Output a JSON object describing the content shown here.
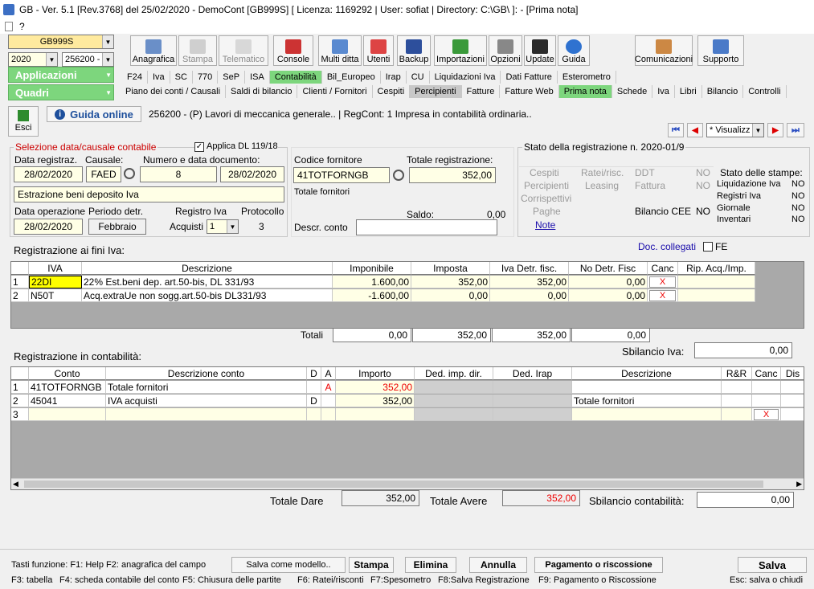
{
  "window": {
    "title": "GB - Ver. 5.1 [Rev.3768] del 25/02/2020 - DemoCont [GB999S]   [ Licenza: 1169292 | User: sofiat | Directory: C:\\GB\\ ]: - [Prima nota]",
    "menu_item": "?"
  },
  "selectors": {
    "company": "GB999S",
    "year": "2020",
    "register": "256200 -"
  },
  "toolbar": [
    "Anagrafica",
    "Stampa",
    "Telematico",
    "Console",
    "Multi ditta",
    "Utenti",
    "Backup",
    "Importazioni",
    "Opzioni",
    "Update",
    "Guida",
    "Comunicazioni",
    "Supporto"
  ],
  "sections": {
    "applicazioni": "Applicazioni",
    "quadri": "Quadri"
  },
  "tabs_row1": [
    "F24",
    "Iva",
    "SC",
    "770",
    "SeP",
    "ISA",
    "Contabilità",
    "Bil_Europeo",
    "Irap",
    "CU",
    "Liquidazioni Iva",
    "Dati Fatture",
    "Esterometro"
  ],
  "tabs_row2": [
    "Piano dei conti / Causali",
    "Saldi di bilancio",
    "Clienti / Fornitori",
    "Cespiti",
    "Percipienti",
    "Fatture",
    "Fatture Web",
    "Prima nota",
    "Schede",
    "Iva",
    "Libri",
    "Bilancio",
    "Controlli"
  ],
  "header": {
    "esci": "Esci",
    "guida_online": "Guida online",
    "info": "256200 - (P) Lavori di meccanica generale.. | RegCont: 1 Impresa  in contabilità ordinaria..",
    "view_mode": "* Visualizz"
  },
  "selezione": {
    "title": "Selezione data/causale contabile",
    "applica_dl": "Applica DL 119/18",
    "lbl_data_reg": "Data registraz.",
    "lbl_causale": "Causale:",
    "lbl_numero_data": "Numero e data documento:",
    "data_reg": "28/02/2020",
    "causale": "FAED",
    "numero": "8",
    "data_doc": "28/02/2020",
    "descr_causale": "Estrazione beni deposito Iva",
    "lbl_data_op": "Data operazione",
    "lbl_periodo": "Periodo detr.",
    "lbl_registro": "Registro Iva",
    "lbl_protocollo": "Protocollo",
    "data_op": "28/02/2020",
    "periodo": "Febbraio",
    "lbl_acquisti": "Acquisti",
    "registro": "1",
    "protocollo": "3"
  },
  "fornitore": {
    "lbl_codice": "Codice fornitore",
    "lbl_totale": "Totale registrazione:",
    "codice": "41TOTFORNGB",
    "totale": "352,00",
    "descr": "Totale fornitori",
    "lbl_saldo": "Saldo:",
    "saldo": "0,00",
    "lbl_descr_conto": "Descr. conto"
  },
  "stato": {
    "title": "Stato della registrazione n. 2020-01/9",
    "cespiti": "Cespiti",
    "ratei": "Ratei/risc.",
    "ddt": "DDT",
    "no1": "NO",
    "percipienti": "Percipienti",
    "leasing": "Leasing",
    "fattura": "Fattura",
    "no2": "NO",
    "corrispettivi": "Corrispettivi",
    "paghe": "Paghe",
    "bilancio_cee": "Bilancio CEE",
    "no3": "NO",
    "note": "Note",
    "stampe_title": "Stato delle stampe:",
    "stampe": [
      {
        "name": "Liquidazione Iva",
        "val": "NO"
      },
      {
        "name": "Registri Iva",
        "val": "NO"
      },
      {
        "name": "Giornale",
        "val": "NO"
      },
      {
        "name": "Inventari",
        "val": "NO"
      }
    ]
  },
  "iva": {
    "title": "Registrazione ai fini Iva:",
    "doc_collegati": "Doc. collegati",
    "fe": "FE",
    "headers": [
      "IVA",
      "Descrizione",
      "Imponibile",
      "Imposta",
      "Iva Detr. fisc.",
      "No Detr. Fisc",
      "Canc",
      "Rip. Acq./Imp."
    ],
    "rows": [
      {
        "n": "1",
        "iva": "22DI",
        "descr": "22% Est.beni dep. art.50-bis, DL 331/93",
        "imponibile": "1.600,00",
        "imposta": "352,00",
        "detr": "352,00",
        "nodetr": "0,00",
        "canc": "X"
      },
      {
        "n": "2",
        "iva": "N50T",
        "descr": "Acq.extraUe non sogg.art.50-bis DL331/93",
        "imponibile": "-1.600,00",
        "imposta": "0,00",
        "detr": "0,00",
        "nodetr": "0,00",
        "canc": "X"
      }
    ],
    "lbl_totali": "Totali",
    "totali": [
      "0,00",
      "352,00",
      "352,00",
      "0,00"
    ],
    "lbl_sbilancio": "Sbilancio Iva:",
    "sbilancio": "0,00"
  },
  "contab": {
    "title": "Registrazione in contabilità:",
    "headers": [
      "Conto",
      "Descrizione conto",
      "D",
      "A",
      "Importo",
      "Ded. imp. dir.",
      "Ded. Irap",
      "Descrizione",
      "R&R",
      "Canc",
      "Dis"
    ],
    "rows": [
      {
        "n": "1",
        "conto": "41TOTFORNGB",
        "descr": "Totale fornitori",
        "d": "",
        "a": "A",
        "importo": "352,00",
        "descr2": "",
        "canc": ""
      },
      {
        "n": "2",
        "conto": "45041",
        "descr": "IVA acquisti",
        "d": "D",
        "a": "",
        "importo": "352,00",
        "descr2": "Totale fornitori",
        "canc": ""
      },
      {
        "n": "3",
        "conto": "",
        "descr": "",
        "d": "",
        "a": "",
        "importo": "",
        "descr2": "",
        "canc": "X"
      }
    ],
    "lbl_dare": "Totale Dare",
    "dare": "352,00",
    "lbl_avere": "Totale Avere",
    "avere": "352,00",
    "lbl_sbil": "Sbilancio contabilità:",
    "sbil": "0,00"
  },
  "footer": {
    "tasti1": "Tasti funzione: F1: Help  F2: anagrafica del campo",
    "salva_modello": "Salva come modello..",
    "stampa": "Stampa",
    "elimina": "Elimina",
    "annulla": "Annulla",
    "pagamento": "Pagamento o riscossione",
    "salva": "Salva",
    "f3": "F3: tabella",
    "f4": "F4: scheda contabile del conto",
    "f5": "F5: Chiusura delle partite",
    "f6": "F6: Ratei/risconti",
    "f7": "F7:Spesometro",
    "f8": "F8:Salva Registrazione",
    "f9": "F9: Pagamento o Riscossione",
    "esc": "Esc: salva o chiudi"
  },
  "colors": {
    "green": "#7dd67d",
    "red": "#e00000",
    "yellow": "#ffffe6",
    "link": "#1a0dab"
  }
}
